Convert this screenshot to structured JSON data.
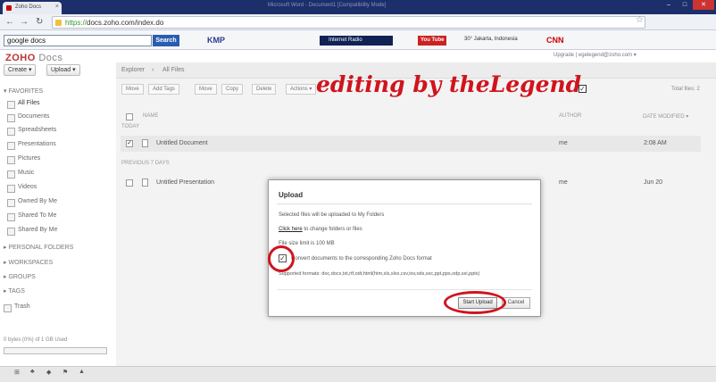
{
  "browser": {
    "tab_title": "Zoho Docs",
    "window_title": "Microsoft Word - Document1 [Compatibility Mode]",
    "url_scheme": "https://",
    "url_rest": "docs.zoho.com/index.do",
    "back_glyph": "←",
    "forward_glyph": "→",
    "reload_glyph": "↻",
    "star_glyph": "☆",
    "minimize_glyph": "–",
    "maximize_glyph": "□",
    "close_glyph": "✕",
    "tab_close_glyph": "×"
  },
  "bookmarks": {
    "search_value": "google docs",
    "search_label": "Search",
    "items": [
      {
        "label": "KMP",
        "color": "#2d3a8c"
      },
      {
        "label": "Internet Radio",
        "color": "#112255"
      },
      {
        "label": "You Tube",
        "color": "#cc2222"
      },
      {
        "label": "30° Jakarta, Indonesia",
        "color": "#333333"
      },
      {
        "label": "CNN",
        "color": "#cc0000"
      }
    ]
  },
  "app": {
    "logo_main": "ZOHO",
    "logo_sub": "Docs",
    "user_links": "Upgrade | egelegend@zoho.com ▾",
    "create_label": "Create ▾",
    "upload_label": "Upload ▾",
    "sidebar": {
      "favorites_label": "▾ FAVORITES",
      "items": [
        {
          "label": "All Files"
        },
        {
          "label": "Documents"
        },
        {
          "label": "Spreadsheets"
        },
        {
          "label": "Presentations"
        },
        {
          "label": "Pictures"
        },
        {
          "label": "Music"
        },
        {
          "label": "Videos"
        },
        {
          "label": "Owned By Me"
        },
        {
          "label": "Shared To Me"
        },
        {
          "label": "Shared By Me"
        }
      ],
      "sections": [
        {
          "label": "▸ PERSONAL FOLDERS"
        },
        {
          "label": "▸ WORKSPACES"
        },
        {
          "label": "▸ GROUPS"
        },
        {
          "label": "▸ TAGS"
        }
      ],
      "trash_label": "Trash",
      "storage_text": "0 bytes (0%) of 1 GB Used",
      "storage_fraction": 0.0
    },
    "breadcrumb": {
      "root": "Explorer",
      "current": "All Files"
    },
    "toolbar": [
      "Move",
      "Add Tags",
      "Move",
      "Copy",
      "Delete",
      "Actions ▾"
    ],
    "file_count": "Total files: 2",
    "columns": {
      "name": "NAME",
      "author": "AUTHOR",
      "modified": "DATE MODIFIED ▾"
    },
    "groups": [
      {
        "label": "TODAY",
        "files": [
          {
            "name": "Untitled Document",
            "author": "me",
            "modified": "2:08 AM",
            "checked": "✓"
          }
        ]
      },
      {
        "label": "PREVIOUS 7 DAYS",
        "files": [
          {
            "name": "Untitled Presentation",
            "author": "me",
            "modified": "Jun 20",
            "checked": ""
          }
        ]
      }
    ]
  },
  "watermark": "editing by theLegend",
  "watermark_check": "✓",
  "dialog": {
    "title": "Upload",
    "line1": "Selected files will be uploaded to My Folders",
    "link": "Click here",
    "link_suffix": " to change folders or files",
    "size_limit": "File size limit is 100 MB",
    "convert_check": "✓",
    "convert_label": "Convert documents to the corresponding Zoho Docs format",
    "supported_formats": "Supported formats: doc,docx,txt,rtf,odt,html(htm,xls,xlsx,csv,tsv,ods,sxc,ppt,pps,odp,sxi,pptx)",
    "start_label": "Start Upload",
    "cancel_label": "Cancel",
    "highlight_color": "#d0141d"
  },
  "taskbar": {
    "icons": [
      "⊞",
      "♣",
      "◆",
      "⚑",
      "▲"
    ]
  }
}
